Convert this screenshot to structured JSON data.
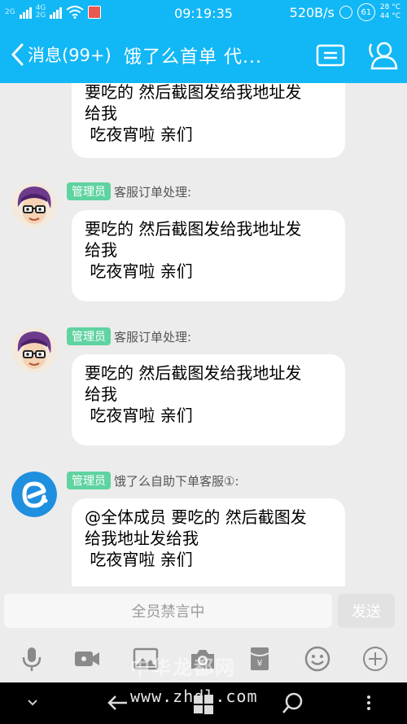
{
  "status_bar": {
    "sim1": "2G",
    "sim2_top": "4G",
    "sim2_bottom": "2G",
    "time": "09:19:35",
    "speed": "520B/s",
    "battery": "61",
    "temp1": "28 °C",
    "temp2": "44 °C"
  },
  "title_bar": {
    "back_label": "消息(99+)",
    "title": "饿了么首单  代...",
    "card_icon": "profile-card-icon",
    "group_icon": "group-members-icon"
  },
  "messages": [
    {
      "avatar": "",
      "role": "",
      "sender": "",
      "text": "要吃的 然后截图发给我地址发\n给我\n 吃夜宵啦 亲们"
    },
    {
      "avatar": "cartoon-avatar",
      "role": "管理员",
      "sender": "客服订单处理:",
      "text": "要吃的 然后截图发给我地址发\n给我\n 吃夜宵啦 亲们"
    },
    {
      "avatar": "cartoon-avatar",
      "role": "管理员",
      "sender": "客服订单处理:",
      "text": "要吃的 然后截图发给我地址发\n给我\n 吃夜宵啦 亲们"
    },
    {
      "avatar": "eleme-logo-avatar",
      "role": "管理员",
      "sender": "饿了么自助下单客服①:",
      "text": "@全体成员 要吃的 然后截图发\n给我地址发给我\n 吃夜宵啦 亲们"
    }
  ],
  "input": {
    "muted_text": "全员禁言中",
    "send_label": "发送"
  },
  "toolbar": [
    "microphone-icon",
    "video-icon",
    "image-icon",
    "camera-icon",
    "red-packet-icon",
    "emoji-icon",
    "plus-icon"
  ],
  "colors": {
    "header": "#12b7f5",
    "badge": "#5fd3a0",
    "background": "#ececec"
  },
  "watermark": "中华龙都网",
  "nav_url": "www.zhdl.com"
}
